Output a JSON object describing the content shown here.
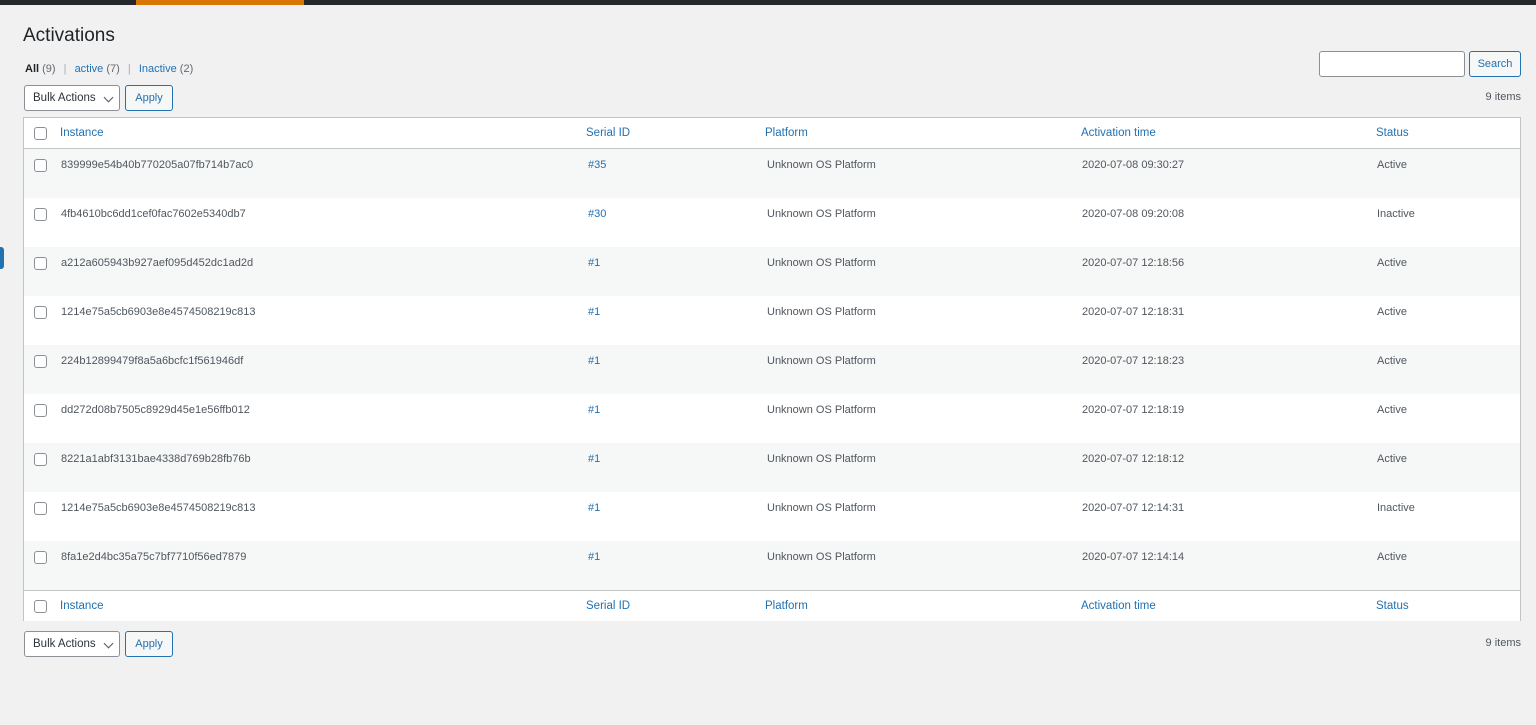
{
  "header": {
    "title": "Activations"
  },
  "filters": [
    {
      "label": "All",
      "count": "(9)"
    },
    {
      "label": "active",
      "count": "(7)"
    },
    {
      "label": "Inactive",
      "count": "(2)"
    }
  ],
  "search": {
    "value": "",
    "button_label": "Search"
  },
  "bulk": {
    "select_label": "Bulk Actions",
    "apply_label": "Apply"
  },
  "items_count": "9 items",
  "columns": {
    "instance": "Instance",
    "serial": "Serial ID",
    "platform": "Platform",
    "time": "Activation time",
    "status": "Status"
  },
  "rows": [
    {
      "instance": "839999e54b40b770205a07fb714b7ac0",
      "serial": "#35",
      "platform": "Unknown OS Platform",
      "time": "2020-07-08 09:30:27",
      "status": "Active"
    },
    {
      "instance": "4fb4610bc6dd1cef0fac7602e5340db7",
      "serial": "#30",
      "platform": "Unknown OS Platform",
      "time": "2020-07-08 09:20:08",
      "status": "Inactive"
    },
    {
      "instance": "a212a605943b927aef095d452dc1ad2d",
      "serial": "#1",
      "platform": "Unknown OS Platform",
      "time": "2020-07-07 12:18:56",
      "status": "Active"
    },
    {
      "instance": "1214e75a5cb6903e8e4574508219c813",
      "serial": "#1",
      "platform": "Unknown OS Platform",
      "time": "2020-07-07 12:18:31",
      "status": "Active"
    },
    {
      "instance": "224b12899479f8a5a6bcfc1f561946df",
      "serial": "#1",
      "platform": "Unknown OS Platform",
      "time": "2020-07-07 12:18:23",
      "status": "Active"
    },
    {
      "instance": "dd272d08b7505c8929d45e1e56ffb012",
      "serial": "#1",
      "platform": "Unknown OS Platform",
      "time": "2020-07-07 12:18:19",
      "status": "Active"
    },
    {
      "instance": "8221a1abf3131bae4338d769b28fb76b",
      "serial": "#1",
      "platform": "Unknown OS Platform",
      "time": "2020-07-07 12:18:12",
      "status": "Active"
    },
    {
      "instance": "1214e75a5cb6903e8e4574508219c813",
      "serial": "#1",
      "platform": "Unknown OS Platform",
      "time": "2020-07-07 12:14:31",
      "status": "Inactive"
    },
    {
      "instance": "8fa1e2d4bc35a75c7bf7710f56ed7879",
      "serial": "#1",
      "platform": "Unknown OS Platform",
      "time": "2020-07-07 12:14:14",
      "status": "Active"
    }
  ]
}
